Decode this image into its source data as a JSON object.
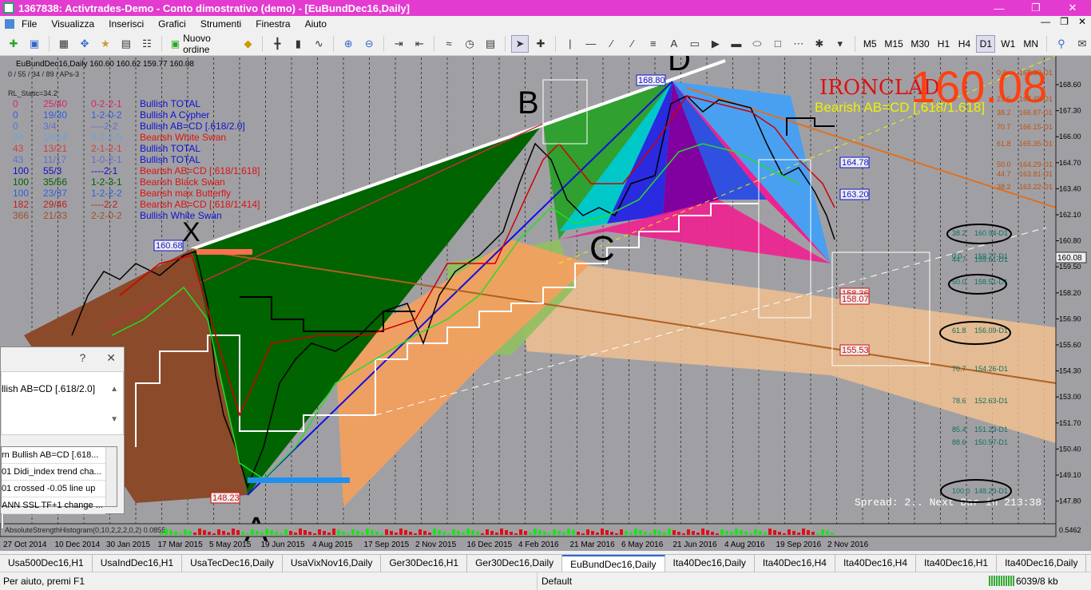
{
  "window": {
    "title": "1367838: Activtrades-Demo - Conto dimostrativo (demo) - [EuBundDec16,Daily]"
  },
  "menu": [
    "File",
    "Visualizza",
    "Inserisci",
    "Grafici",
    "Strumenti",
    "Finestra",
    "Aiuto"
  ],
  "toolbar": {
    "new_order": "Nuovo ordine",
    "timeframes": [
      "M5",
      "M15",
      "M30",
      "H1",
      "H4",
      "D1",
      "W1",
      "MN"
    ],
    "active_tf": "D1"
  },
  "chart": {
    "header": "EuBundDec16,Daily  160.60 160.62 159.77 160.08",
    "sub1": "0 / 55 / 34 / 89 / APs-3",
    "sub2": "RL_Static=34.2",
    "big_price": "160.08",
    "brand": "IRONCLAD",
    "pattern_label": "Bearish AB=CD [.618/1.618]",
    "spread": "Spread: 2.. Next Bar in 213:38",
    "current_price": "160.08",
    "legend": [
      {
        "a": "0",
        "b": "25/40",
        "c": "0-2-2-1",
        "name": "Bullish TOTAL",
        "cl": "#e0206a",
        "nc": "#1010d0"
      },
      {
        "a": "0",
        "b": "19/30",
        "c": "1-2-0-2",
        "name": "Bullish A Cypher",
        "cl": "#3060e0",
        "nc": "#1010d0"
      },
      {
        "a": "0",
        "b": "3/4",
        "c": "----2-2",
        "name": "Bullish AB=CD [.618/2.0]",
        "cl": "#6070d0",
        "nc": "#1010d0"
      },
      {
        "a": "30",
        "b": "15/24",
        "c": "0-2-1-0",
        "name": "Bearish White Swan",
        "cl": "#70a0d0",
        "nc": "#e01010"
      },
      {
        "a": "43",
        "b": "13/21",
        "c": "2-1-2-1",
        "name": "Bullish TOTAL",
        "cl": "#d04040",
        "nc": "#1010d0"
      },
      {
        "a": "43",
        "b": "11/17",
        "c": "1-0-2-1",
        "name": "Bullish TOTAL",
        "cl": "#6070d0",
        "nc": "#1010d0"
      },
      {
        "a": "100",
        "b": "55/3",
        "c": "----2-1",
        "name": "Bearish AB=CD [.618/1.618]",
        "cl": "#1010c0",
        "nc": "#e01010"
      },
      {
        "a": "100",
        "b": "35/56",
        "c": "1-2-3-1",
        "name": "Bearish Black Swan",
        "cl": "#006000",
        "nc": "#e01010"
      },
      {
        "a": "100",
        "b": "23/37",
        "c": "1-2-2-2",
        "name": "Bearish max Butterfly",
        "cl": "#3060e0",
        "nc": "#e01010"
      },
      {
        "a": "182",
        "b": "29/46",
        "c": "----2-2",
        "name": "Bearish AB=CD [.618/1.414]",
        "cl": "#c02020",
        "nc": "#e01010"
      },
      {
        "a": "366",
        "b": "21/33",
        "c": "2-2-0-2",
        "name": "Bullish White Swan",
        "cl": "#a05030",
        "nc": "#1010d0"
      }
    ],
    "price_boxes": [
      {
        "label": "168.80",
        "c": "blue"
      },
      {
        "label": "160.68",
        "c": "blue"
      },
      {
        "label": "148.23",
        "c": "red"
      },
      {
        "label": "164.78",
        "c": "blue"
      },
      {
        "label": "163.20",
        "c": "blue"
      },
      {
        "label": "158.36",
        "c": "red"
      },
      {
        "label": "158.07",
        "c": "red"
      },
      {
        "label": "155.53",
        "c": "red"
      }
    ],
    "points": {
      "X": "X",
      "A": "A",
      "B": "B",
      "C": "C",
      "D": "D"
    },
    "fib_levels": [
      {
        "pct": "0.0",
        "val": "168.80-D1"
      },
      {
        "pct": "23.6",
        "val": "167.48-D1"
      },
      {
        "pct": "38.2",
        "val": "166.87-D1"
      },
      {
        "pct": "70.7",
        "val": "166.15-D1"
      },
      {
        "pct": "61.8",
        "val": "165.35-D1"
      },
      {
        "pct": "50.0",
        "val": "164.29-D1"
      },
      {
        "pct": "44.7",
        "val": "163.81-D1"
      },
      {
        "pct": "38.2",
        "val": "163.22-D1"
      },
      {
        "pct": "38.2",
        "val": "160.94-D1"
      },
      {
        "pct": "44.7",
        "val": "159.61-D1"
      },
      {
        "pct": "0.0",
        "val": "159.77-D1"
      },
      {
        "pct": "50.0",
        "val": "158.51-D1"
      },
      {
        "pct": "61.8",
        "val": "156.09-D1"
      },
      {
        "pct": "70.7",
        "val": "154.26-D1"
      },
      {
        "pct": "78.6",
        "val": "152.63-D1"
      },
      {
        "pct": "85.4",
        "val": "151.23-D1"
      },
      {
        "pct": "88.6",
        "val": "150.57-D1"
      },
      {
        "pct": "100.0",
        "val": "148.23-D1"
      }
    ],
    "y_axis": [
      "168.60",
      "167.30",
      "166.00",
      "164.70",
      "163.40",
      "162.10",
      "160.80",
      "159.50",
      "158.20",
      "156.90",
      "155.60",
      "154.30",
      "153.00",
      "151.70",
      "150.40",
      "149.10",
      "147.80"
    ],
    "x_axis": [
      "27 Oct 2014",
      "10 Dec 2014",
      "30 Jan 2015",
      "17 Mar 2015",
      "5 May 2015",
      "19 Jun 2015",
      "4 Aug 2015",
      "17 Sep 2015",
      "2 Nov 2015",
      "16 Dec 2015",
      "4 Feb 2016",
      "21 Mar 2016",
      "6 May 2016",
      "21 Jun 2016",
      "4 Aug 2016",
      "19 Sep 2016",
      "2 Nov 2016"
    ],
    "subwindow": {
      "label": "AbsoluteStrengthHistogram(0,10,2,2,2,0,2) 0.0855",
      "right": "0.5462"
    }
  },
  "dialog": {
    "help": "?",
    "close": "✕",
    "header": "llish AB=CD [.618/2.0]",
    "items": [
      "rn Bullish AB=CD [.618...",
      "01 Didi_index trend cha...",
      "01 crossed -0.05 line up",
      "ANN SSL TF+1 change ..."
    ]
  },
  "tabs": [
    "Usa500Dec16,H1",
    "UsaIndDec16,H1",
    "UsaTecDec16,Daily",
    "UsaVixNov16,Daily",
    "Ger30Dec16,H1",
    "Ger30Dec16,Daily",
    "EuBundDec16,Daily",
    "Ita40Dec16,Daily",
    "Ita40Dec16,H4",
    "Ita40Dec16,H4",
    "Ita40Dec16,H1",
    "Ita40Dec16,Daily",
    "Ita40"
  ],
  "active_tab": "EuBundDec16,Daily",
  "status": {
    "help": "Per aiuto, premi F1",
    "profile": "Default",
    "traffic": "6039/8 kb"
  }
}
